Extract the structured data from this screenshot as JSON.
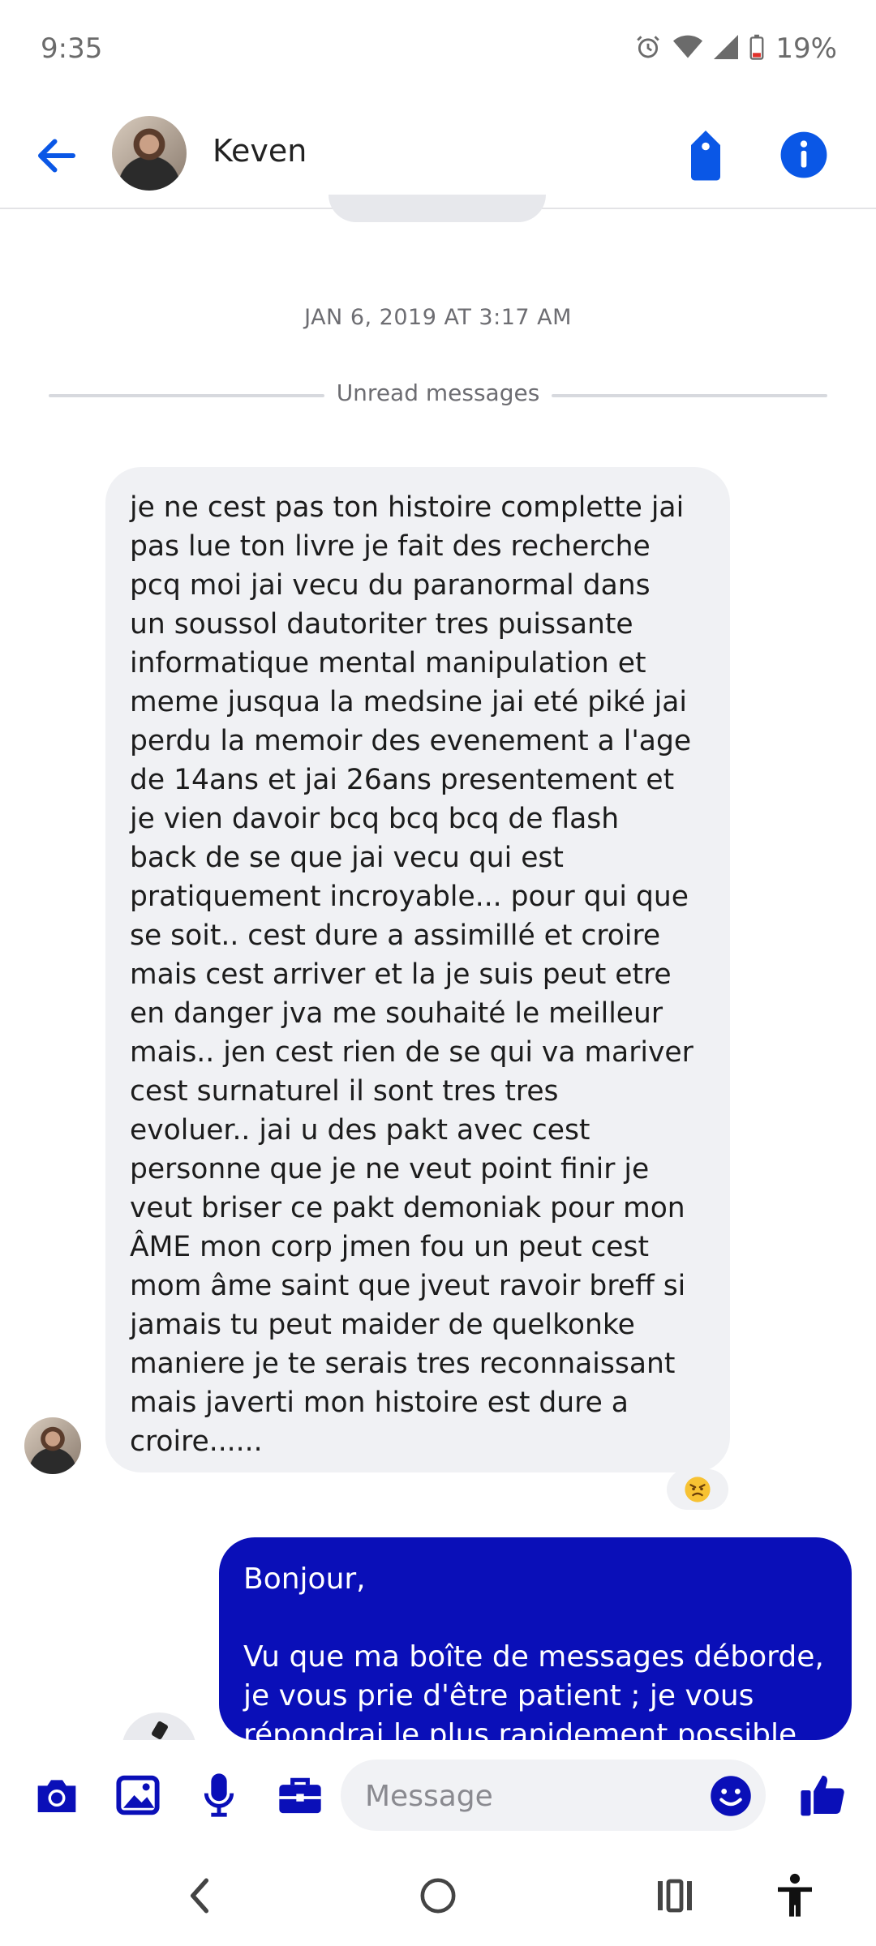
{
  "status_bar": {
    "time": "9:35",
    "battery": "19%"
  },
  "header": {
    "contact_name": "Keven"
  },
  "conversation": {
    "timestamp": "JAN 6, 2019 AT 3:17 AM",
    "unread_label": "Unread messages",
    "incoming_message": "je ne cest pas ton histoire complette jai\npas lue ton livre je fait des recherche\npcq moi jai vecu du paranormal dans\nun soussol dautoriter tres puissante\ninformatique mental manipulation et\nmeme jusqua la medsine jai eté piké jai\nperdu la memoir des evenement a l'age\nde 14ans et jai 26ans presentement et\nje vien davoir bcq bcq bcq de flash\nback de se que jai vecu qui est\npratiquement incroyable... pour qui que\nse soit.. cest dure a assimillé et croire\nmais cest arriver et la je suis peut etre\nen danger jva me souhaité le meilleur\nmais.. jen cest rien de se qui va mariver\ncest surnaturel il sont tres tres\nevoluer.. jai u des pakt avec cest\npersonne que je ne veut point finir je\nveut briser ce pakt demoniak pour mon\nÂME mon corp jmen fou un peut cest\nmom âme saint que jveut ravoir breff si\njamais tu peut maider de quelkonke\nmaniere je te serais tres reconnaissant\nmais javerti mon histoire est dure a\ncroire......",
    "reaction_emoji": "angry-face",
    "outgoing_message": "Bonjour,\n\nVu que ma boîte de messages déborde,\nje vous prie d'être patient ; je vous\nrépondrai le plus rapidement possible."
  },
  "composer": {
    "placeholder": "Message"
  },
  "colors": {
    "accent": "#0a57e6",
    "outgoing_bubble": "#0a0fb8",
    "incoming_bubble": "#f0f1f4"
  },
  "icons": {
    "header": [
      "back-arrow-icon",
      "tag-icon",
      "info-icon"
    ],
    "composer": [
      "camera-icon",
      "gallery-icon",
      "microphone-icon",
      "briefcase-icon",
      "emoji-icon",
      "thumbs-up-icon"
    ],
    "navigation": [
      "nav-back-icon",
      "nav-home-icon",
      "nav-recents-icon",
      "accessibility-icon"
    ]
  }
}
